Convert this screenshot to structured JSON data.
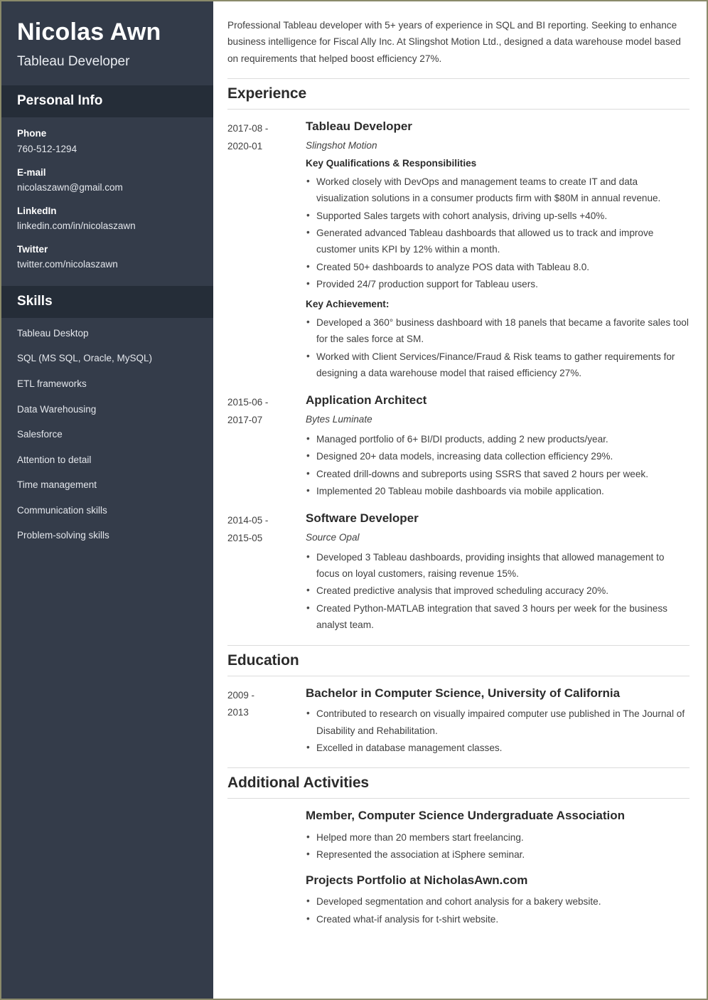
{
  "theme": {
    "sidebar_bg": "#343c4a",
    "sidebar_header_bg": "#333b49",
    "sidebar_section_bg": "#252d38",
    "page_border": "#8a8a6a",
    "rule_color": "#dcdcdc",
    "text_color": "#3f3f3f"
  },
  "sidebar": {
    "name": "Nicolas Awn",
    "job_title": "Tableau Developer",
    "personal_info": {
      "heading": "Personal Info",
      "items": [
        {
          "label": "Phone",
          "value": "760-512-1294"
        },
        {
          "label": "E-mail",
          "value": "nicolaszawn@gmail.com"
        },
        {
          "label": "LinkedIn",
          "value": "linkedin.com/in/nicolaszawn"
        },
        {
          "label": "Twitter",
          "value": "twitter.com/nicolaszawn"
        }
      ]
    },
    "skills": {
      "heading": "Skills",
      "items": [
        "Tableau Desktop",
        "SQL (MS SQL, Oracle, MySQL)",
        "ETL frameworks",
        "Data Warehousing",
        "Salesforce",
        "Attention to detail",
        "Time management",
        "Communication skills",
        "Problem-solving skills"
      ]
    }
  },
  "main": {
    "summary": "Professional Tableau developer with 5+ years of experience in SQL and BI reporting. Seeking to enhance business intelligence for Fiscal Ally Inc. At Slingshot Motion Ltd., designed a data warehouse model based on requirements that helped boost efficiency 27%.",
    "experience": {
      "heading": "Experience",
      "entries": [
        {
          "date_start": "2017-08 -",
          "date_end": "2020-01",
          "role": "Tableau Developer",
          "company": "Slingshot Motion",
          "subhead_1": "Key Qualifications & Responsibilities",
          "bullets_1": [
            "Worked closely with DevOps and management teams to create IT and data visualization solutions in a consumer products firm with $80M in annual revenue.",
            "Supported Sales targets with cohort analysis, driving up-sells +40%.",
            "Generated advanced Tableau dashboards that allowed us to track and improve customer units KPI by 12% within a month.",
            "Created 50+ dashboards to analyze POS data with Tableau 8.0.",
            "Provided 24/7 production support for Tableau users."
          ],
          "subhead_2": "Key Achievement:",
          "bullets_2": [
            "Developed a 360° business dashboard with 18 panels that became a favorite sales tool for the sales force at SM.",
            "Worked with Client Services/Finance/Fraud & Risk teams to gather requirements for designing a data warehouse model that raised efficiency 27%."
          ]
        },
        {
          "date_start": "2015-06 -",
          "date_end": "2017-07",
          "role": "Application Architect",
          "company": "Bytes Luminate",
          "bullets_1": [
            "Managed portfolio of 6+ BI/DI products, adding 2 new products/year.",
            "Designed 20+ data models, increasing data collection efficiency 29%.",
            "Created drill-downs and subreports using SSRS that saved 2 hours per week.",
            "Implemented 20 Tableau mobile dashboards via mobile application."
          ]
        },
        {
          "date_start": "2014-05 -",
          "date_end": "2015-05",
          "role": "Software Developer",
          "company": "Source Opal",
          "bullets_1": [
            "Developed 3 Tableau dashboards, providing insights that allowed management to focus on loyal customers, raising revenue 15%.",
            "Created predictive analysis that improved scheduling accuracy 20%.",
            "Created Python-MATLAB integration that saved 3 hours per week for the business analyst team."
          ]
        }
      ]
    },
    "education": {
      "heading": "Education",
      "entries": [
        {
          "date_start": "2009 -",
          "date_end": "2013",
          "degree": "Bachelor in Computer Science, University of California",
          "bullets": [
            "Contributed to research on visually impaired computer use published in The Journal of Disability and Rehabilitation.",
            "Excelled in database management classes."
          ]
        }
      ]
    },
    "additional_activities": {
      "heading": "Additional Activities",
      "entries": [
        {
          "title": "Member, Computer Science Undergraduate Association",
          "bullets": [
            "Helped more than 20 members start freelancing.",
            "Represented the association at iSphere seminar."
          ]
        },
        {
          "title": "Projects Portfolio at NicholasAwn.com",
          "bullets": [
            "Developed segmentation and cohort analysis for a bakery website.",
            "Created what-if analysis for t-shirt website."
          ]
        }
      ]
    }
  }
}
